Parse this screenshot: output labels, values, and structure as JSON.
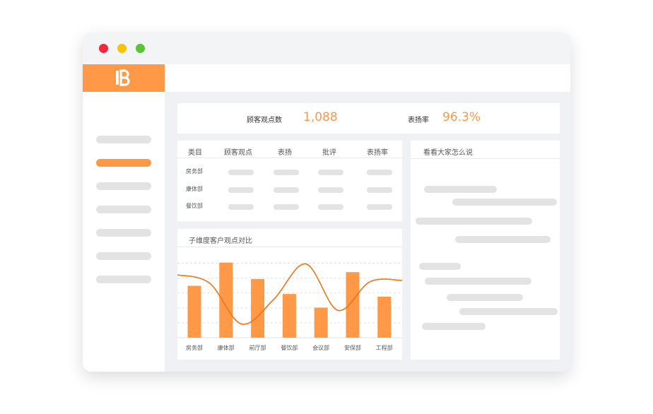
{
  "window": {
    "controls": [
      "close",
      "minimize",
      "maximize"
    ],
    "colors": {
      "close": "#f0293e",
      "minimize": "#f8c20a",
      "maximize": "#5ac336"
    }
  },
  "sidebar": {
    "logo_icon": "brand-logo-icon",
    "accent_color": "#ff9847",
    "items": [
      {
        "active": false
      },
      {
        "active": true
      },
      {
        "active": false
      },
      {
        "active": false
      },
      {
        "active": false
      },
      {
        "active": false
      },
      {
        "active": false
      }
    ]
  },
  "stats": {
    "opinions_label": "顾客观点数",
    "opinions_value": "1,088",
    "praise_rate_label": "表扬率",
    "praise_rate_value": "96.3%"
  },
  "table": {
    "headers": [
      "类目",
      "顾客观点",
      "表扬",
      "批评",
      "表扬率"
    ],
    "rows": [
      "房务部",
      "康体部",
      "餐饮部"
    ]
  },
  "chart": {
    "title": "子维度客户观点对比"
  },
  "chart_data": {
    "type": "bar",
    "categories": [
      "房务部",
      "康体部",
      "前厅部",
      "餐饮部",
      "会议部",
      "安保部",
      "工程部"
    ],
    "values": [
      38,
      55,
      43,
      32,
      22,
      48,
      30
    ],
    "ylim": [
      0,
      60
    ],
    "grid": true,
    "bar_color": "#ff9847",
    "line_color": "#f07417",
    "line": {
      "x": [
        0,
        1,
        2,
        3,
        4,
        5,
        6,
        7
      ],
      "values": [
        46,
        40,
        10,
        28,
        54,
        20,
        41,
        42
      ]
    }
  },
  "reviews": {
    "title": "看看大家怎么说"
  }
}
